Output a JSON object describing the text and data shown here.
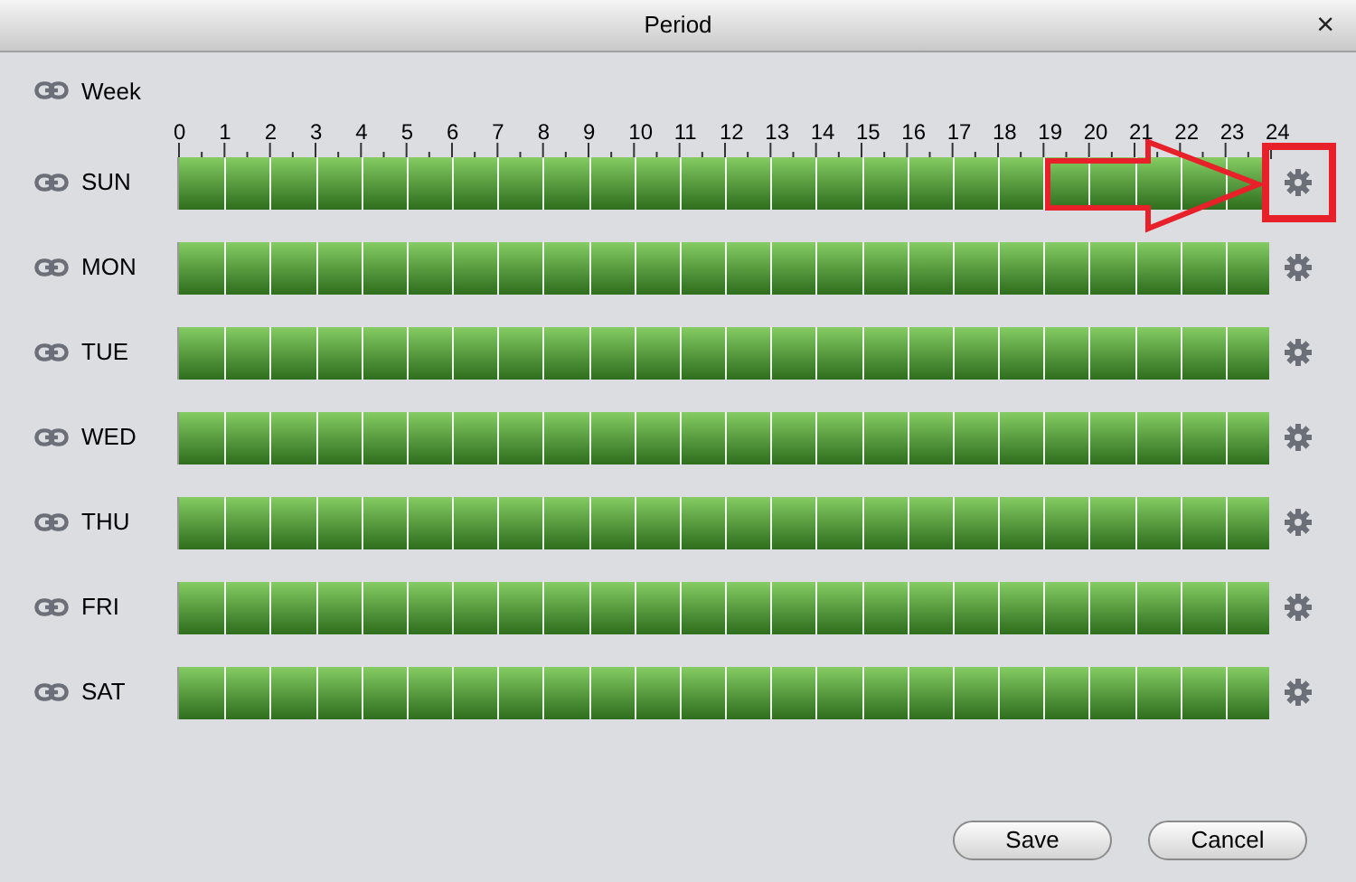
{
  "window": {
    "title": "Period",
    "close": "×"
  },
  "week": {
    "label": "Week"
  },
  "hours": [
    "0",
    "1",
    "2",
    "3",
    "4",
    "5",
    "6",
    "7",
    "8",
    "9",
    "10",
    "11",
    "12",
    "13",
    "14",
    "15",
    "16",
    "17",
    "18",
    "19",
    "20",
    "21",
    "22",
    "23",
    "24"
  ],
  "days": [
    {
      "label": "SUN",
      "level": 1,
      "highlighted": true
    },
    {
      "label": "MON",
      "level": 1,
      "highlighted": false
    },
    {
      "label": "TUE",
      "level": 1,
      "highlighted": false
    },
    {
      "label": "WED",
      "level": 1,
      "highlighted": false
    },
    {
      "label": "THU",
      "level": 1,
      "highlighted": false
    },
    {
      "label": "FRI",
      "level": 1,
      "highlighted": false
    },
    {
      "label": "SAT",
      "level": 1,
      "highlighted": false
    }
  ],
  "buttons": [
    "Save",
    "Cancel"
  ]
}
